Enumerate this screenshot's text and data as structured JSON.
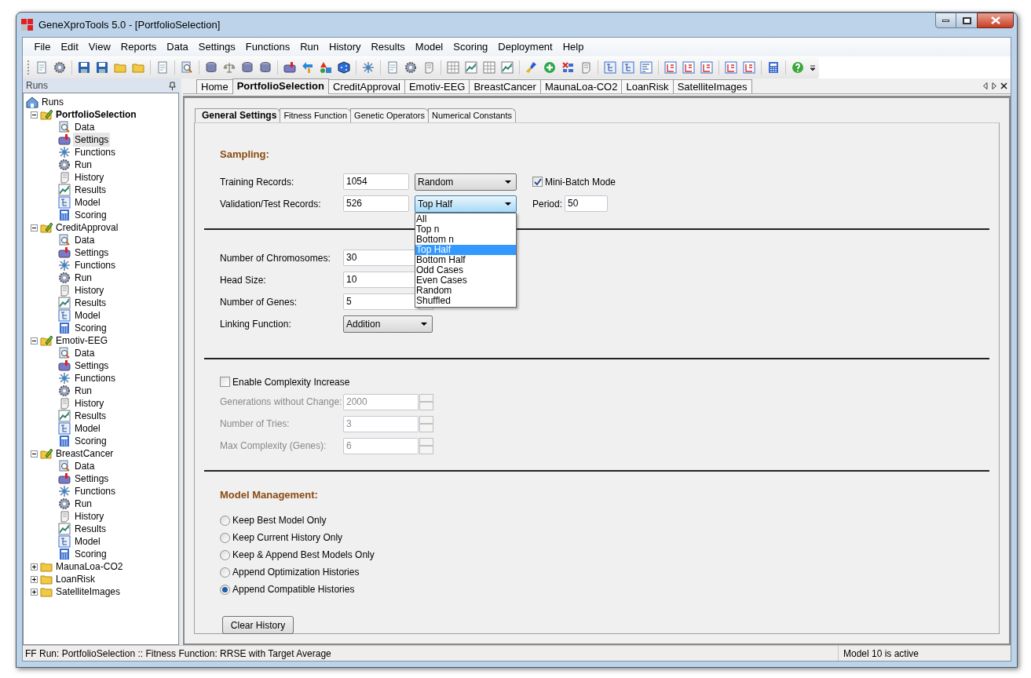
{
  "window": {
    "title": "GeneXproTools 5.0 - [PortfolioSelection]"
  },
  "menu": [
    "File",
    "Edit",
    "View",
    "Reports",
    "Data",
    "Settings",
    "Functions",
    "Run",
    "History",
    "Results",
    "Model",
    "Scoring",
    "Deployment",
    "Help"
  ],
  "sidebar": {
    "title": "Runs",
    "tree": {
      "label": "Runs",
      "children": [
        {
          "label": "PortfolioSelection",
          "active": true,
          "expanded": true,
          "children": [
            {
              "label": "Data",
              "selected": false
            },
            {
              "label": "Settings",
              "selected": true
            },
            {
              "label": "Functions",
              "selected": false
            },
            {
              "label": "Run",
              "selected": false
            },
            {
              "label": "History",
              "selected": false
            },
            {
              "label": "Results",
              "selected": false
            },
            {
              "label": "Model",
              "selected": false
            },
            {
              "label": "Scoring",
              "selected": false
            }
          ]
        },
        {
          "label": "CreditApproval",
          "active": false,
          "expanded": true,
          "children": [
            {
              "label": "Data",
              "selected": false
            },
            {
              "label": "Settings",
              "selected": false
            },
            {
              "label": "Functions",
              "selected": false
            },
            {
              "label": "Run",
              "selected": false
            },
            {
              "label": "History",
              "selected": false
            },
            {
              "label": "Results",
              "selected": false
            },
            {
              "label": "Model",
              "selected": false
            },
            {
              "label": "Scoring",
              "selected": false
            }
          ]
        },
        {
          "label": "Emotiv-EEG",
          "active": false,
          "expanded": true,
          "children": [
            {
              "label": "Data",
              "selected": false
            },
            {
              "label": "Settings",
              "selected": false
            },
            {
              "label": "Functions",
              "selected": false
            },
            {
              "label": "Run",
              "selected": false
            },
            {
              "label": "History",
              "selected": false
            },
            {
              "label": "Results",
              "selected": false
            },
            {
              "label": "Model",
              "selected": false
            },
            {
              "label": "Scoring",
              "selected": false
            }
          ]
        },
        {
          "label": "BreastCancer",
          "active": false,
          "expanded": true,
          "children": [
            {
              "label": "Data",
              "selected": false
            },
            {
              "label": "Settings",
              "selected": false
            },
            {
              "label": "Functions",
              "selected": false
            },
            {
              "label": "Run",
              "selected": false
            },
            {
              "label": "History",
              "selected": false
            },
            {
              "label": "Results",
              "selected": false
            },
            {
              "label": "Model",
              "selected": false
            },
            {
              "label": "Scoring",
              "selected": false
            }
          ]
        },
        {
          "label": "MaunaLoa-CO2",
          "active": false,
          "expanded": false
        },
        {
          "label": "LoanRisk",
          "active": false,
          "expanded": false
        },
        {
          "label": "SatelliteImages",
          "active": false,
          "expanded": false
        }
      ]
    }
  },
  "doc_tabs": [
    {
      "label": "Home",
      "selected": false
    },
    {
      "label": "PortfolioSelection",
      "selected": true
    },
    {
      "label": "CreditApproval",
      "selected": false
    },
    {
      "label": "Emotiv-EEG",
      "selected": false
    },
    {
      "label": "BreastCancer",
      "selected": false
    },
    {
      "label": "MaunaLoa-CO2",
      "selected": false
    },
    {
      "label": "LoanRisk",
      "selected": false
    },
    {
      "label": "SatelliteImages",
      "selected": false
    }
  ],
  "settings_tabs": [
    {
      "label": "General Settings",
      "selected": true
    },
    {
      "label": "Fitness Function",
      "selected": false
    },
    {
      "label": "Genetic Operators",
      "selected": false
    },
    {
      "label": "Numerical Constants",
      "selected": false
    }
  ],
  "sampling": {
    "heading": "Sampling:",
    "training": {
      "label": "Training Records:",
      "value": "1054",
      "method": "Random"
    },
    "validation": {
      "label": "Validation/Test Records:",
      "value": "526",
      "method": "Top Half",
      "expanded": true
    },
    "mini_batch": {
      "label": "Mini-Batch Mode",
      "checked": true
    },
    "period": {
      "label": "Period:",
      "value": "50"
    },
    "options": [
      {
        "label": "All",
        "selected": false
      },
      {
        "label": "Top n",
        "selected": false
      },
      {
        "label": "Bottom n",
        "selected": false
      },
      {
        "label": "Top Half",
        "selected": true
      },
      {
        "label": "Bottom Half",
        "selected": false
      },
      {
        "label": "Odd Cases",
        "selected": false
      },
      {
        "label": "Even Cases",
        "selected": false
      },
      {
        "label": "Random",
        "selected": false
      },
      {
        "label": "Shuffled",
        "selected": false
      }
    ]
  },
  "structure": [
    {
      "kind": "text",
      "label": "Number of Chromosomes:",
      "value": "30"
    },
    {
      "kind": "text",
      "label": "Head Size:",
      "value": "10"
    },
    {
      "kind": "spinner",
      "label": "Number of Genes:",
      "value": "5"
    },
    {
      "kind": "select",
      "label": "Linking Function:",
      "value": "Addition"
    }
  ],
  "complexity": {
    "enable": {
      "label": "Enable Complexity Increase",
      "checked": false
    },
    "fields": [
      {
        "label": "Generations without Change:",
        "value": "2000",
        "disabled": true
      },
      {
        "label": "Number of Tries:",
        "value": "3",
        "disabled": true
      },
      {
        "label": "Max Complexity (Genes):",
        "value": "6",
        "disabled": true
      }
    ]
  },
  "model_management": {
    "heading": "Model Management:",
    "options": [
      {
        "label": "Keep Best Model Only",
        "selected": false
      },
      {
        "label": "Keep Current History Only",
        "selected": false
      },
      {
        "label": "Keep & Append Best Models Only",
        "selected": false
      },
      {
        "label": "Append Optimization Histories",
        "selected": false
      },
      {
        "label": "Append Compatible Histories",
        "selected": true
      }
    ],
    "button": "Clear History"
  },
  "status_bar": {
    "left": "FF Run: PortfolioSelection :: Fitness Function: RRSE with Target Average",
    "right": "Model 10 is active"
  }
}
